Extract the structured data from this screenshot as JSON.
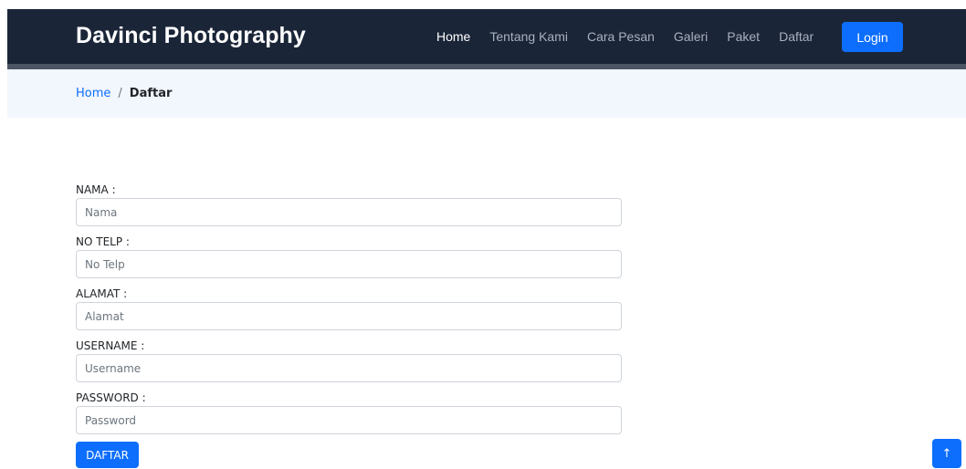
{
  "header": {
    "brand": "Davinci Photography",
    "nav": [
      {
        "label": "Home",
        "active": true
      },
      {
        "label": "Tentang Kami",
        "active": false
      },
      {
        "label": "Cara Pesan",
        "active": false
      },
      {
        "label": "Galeri",
        "active": false
      },
      {
        "label": "Paket",
        "active": false
      },
      {
        "label": "Daftar",
        "active": false
      }
    ],
    "login_label": "Login"
  },
  "breadcrumb": {
    "home": "Home",
    "separator": "/",
    "current": "Daftar"
  },
  "form": {
    "fields": [
      {
        "label": "NAMA :",
        "placeholder": "Nama",
        "value": ""
      },
      {
        "label": "NO TELP :",
        "placeholder": "No Telp",
        "value": ""
      },
      {
        "label": "ALAMAT :",
        "placeholder": "Alamat",
        "value": ""
      },
      {
        "label": "USERNAME :",
        "placeholder": "Username",
        "value": ""
      },
      {
        "label": "PASSWORD :",
        "placeholder": "Password",
        "value": ""
      }
    ],
    "submit_label": "DAFTAR"
  },
  "back_to_top": {
    "icon": "arrow-up-icon",
    "glyph": "↑"
  },
  "colors": {
    "navbar_bg": "#1b2538",
    "accent": "#0d6efd",
    "breadcrumb_bg": "#f2f6fd"
  }
}
